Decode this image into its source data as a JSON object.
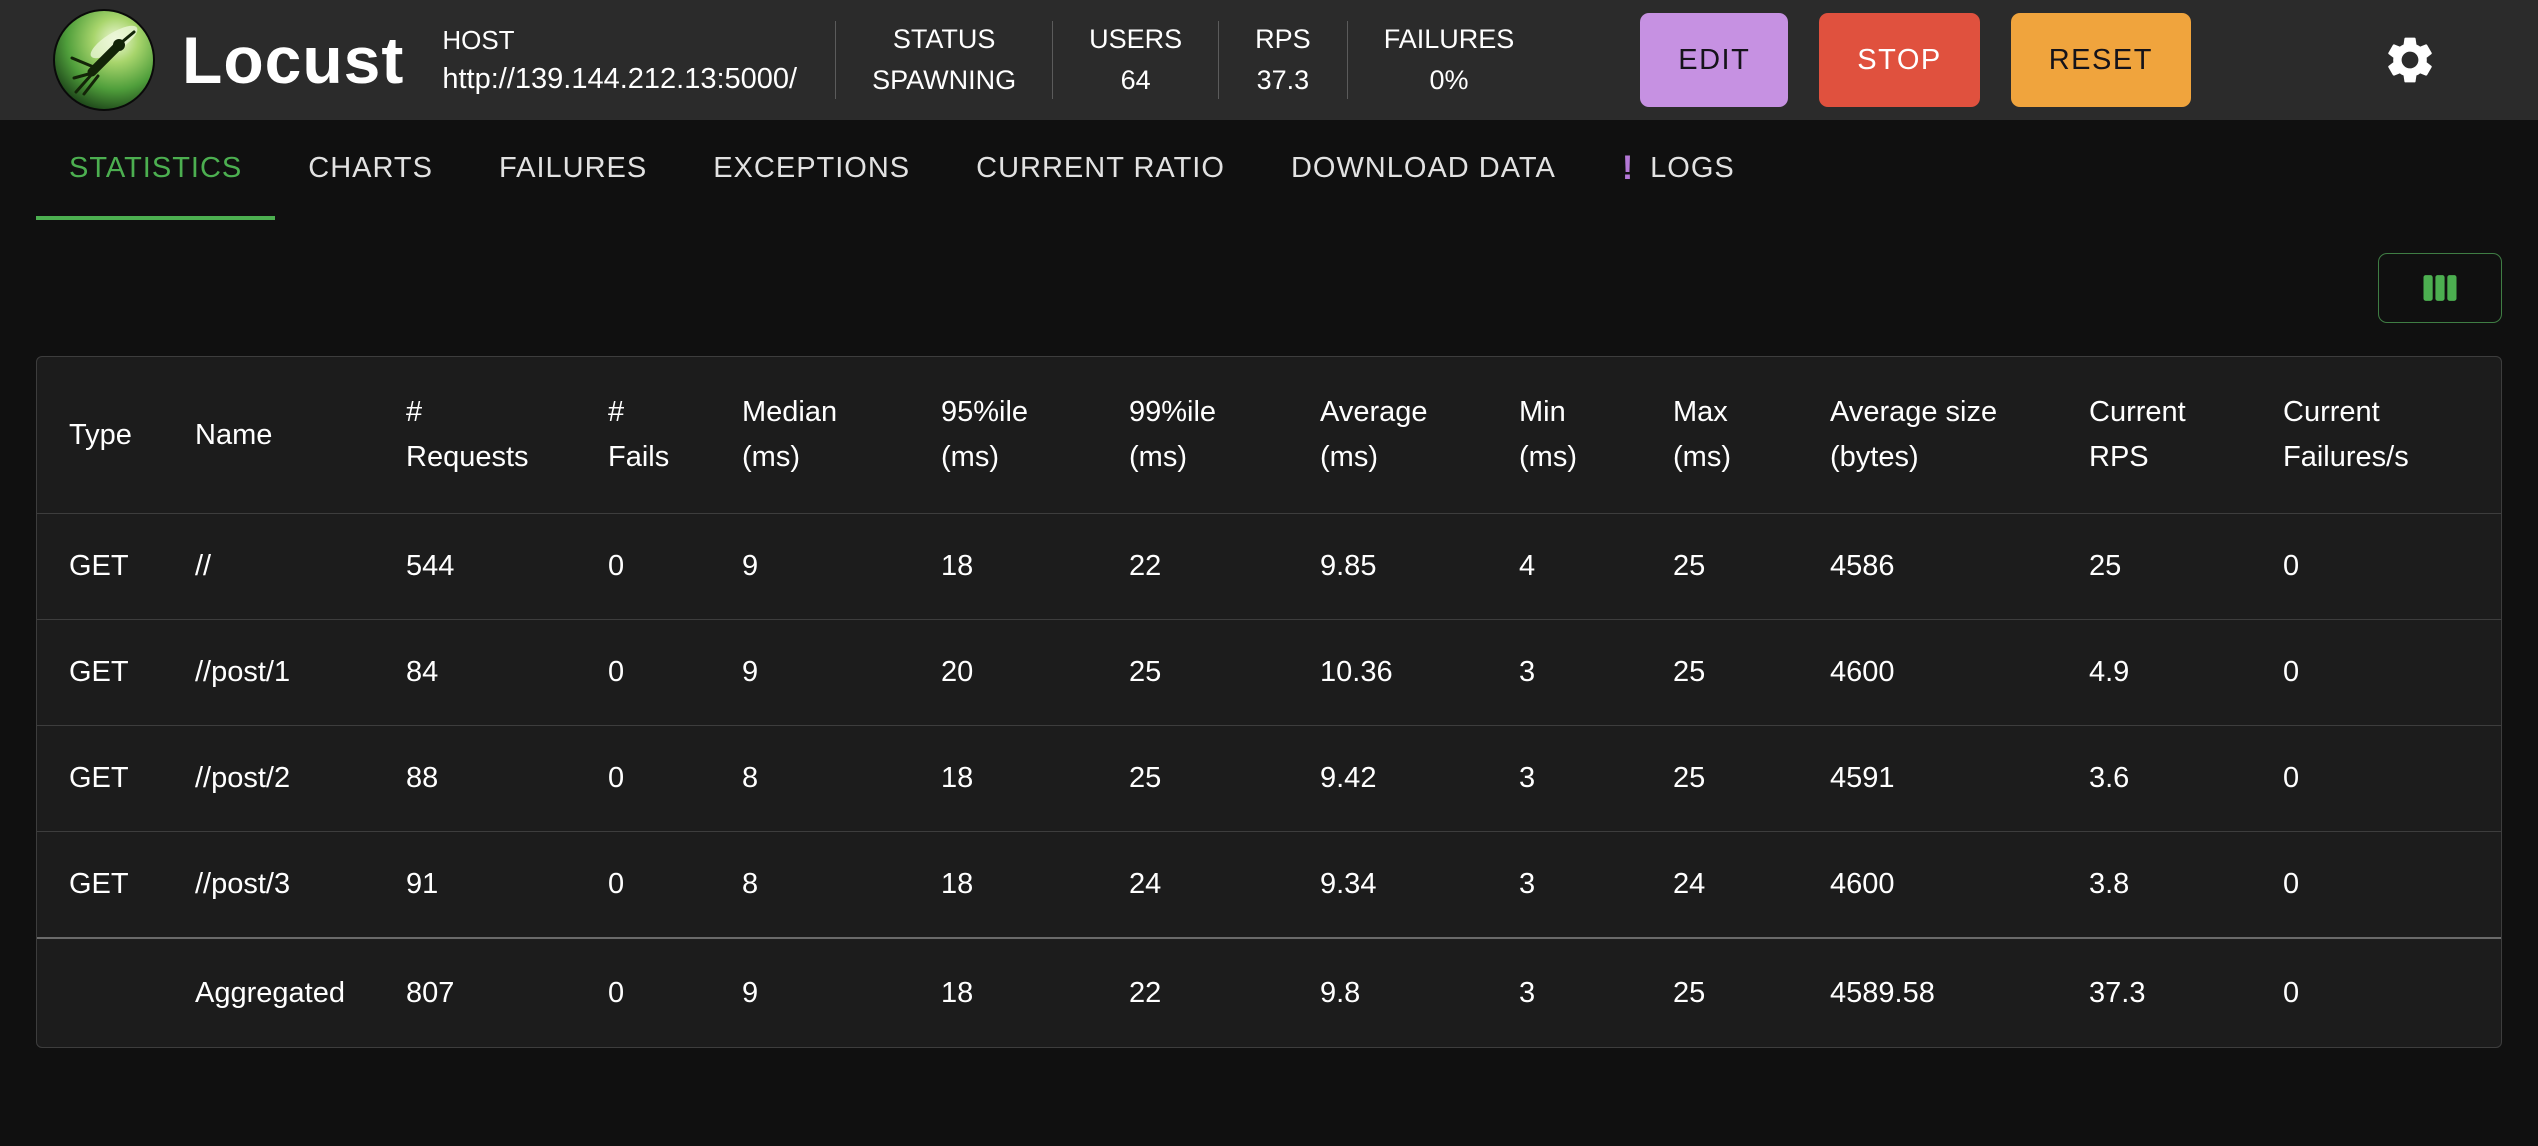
{
  "header": {
    "app_title": "Locust",
    "host_label": "HOST",
    "host_url": "http://139.144.212.13:5000/",
    "stats": [
      {
        "label": "STATUS",
        "value": "SPAWNING"
      },
      {
        "label": "USERS",
        "value": "64"
      },
      {
        "label": "RPS",
        "value": "37.3"
      },
      {
        "label": "FAILURES",
        "value": "0%"
      }
    ],
    "edit_label": "EDIT",
    "stop_label": "STOP",
    "reset_label": "RESET"
  },
  "tabs": [
    {
      "id": "statistics",
      "label": "STATISTICS",
      "active": true
    },
    {
      "id": "charts",
      "label": "CHARTS"
    },
    {
      "id": "failures",
      "label": "FAILURES"
    },
    {
      "id": "exceptions",
      "label": "EXCEPTIONS"
    },
    {
      "id": "current-ratio",
      "label": "CURRENT RATIO"
    },
    {
      "id": "download-data",
      "label": "DOWNLOAD DATA"
    },
    {
      "id": "logs",
      "label": "LOGS",
      "badge": "!"
    }
  ],
  "toolbar": {
    "columns_button_icon": "view-columns-icon"
  },
  "table": {
    "columns": [
      "Type",
      "Name",
      "#\nRequests",
      "#\nFails",
      "Median\n(ms)",
      "95%ile\n(ms)",
      "99%ile\n(ms)",
      "Average\n(ms)",
      "Min\n(ms)",
      "Max\n(ms)",
      "Average size\n(bytes)",
      "Current\nRPS",
      "Current\nFailures/s"
    ],
    "rows": [
      [
        "GET",
        "//",
        "544",
        "0",
        "9",
        "18",
        "22",
        "9.85",
        "4",
        "25",
        "4586",
        "25",
        "0"
      ],
      [
        "GET",
        "//post/1",
        "84",
        "0",
        "9",
        "20",
        "25",
        "10.36",
        "3",
        "25",
        "4600",
        "4.9",
        "0"
      ],
      [
        "GET",
        "//post/2",
        "88",
        "0",
        "8",
        "18",
        "25",
        "9.42",
        "3",
        "25",
        "4591",
        "3.6",
        "0"
      ],
      [
        "GET",
        "//post/3",
        "91",
        "0",
        "8",
        "18",
        "24",
        "9.34",
        "3",
        "24",
        "4600",
        "3.8",
        "0"
      ]
    ],
    "aggregated": [
      "",
      "Aggregated",
      "807",
      "0",
      "9",
      "18",
      "22",
      "9.8",
      "3",
      "25",
      "4589.58",
      "37.3",
      "0"
    ]
  },
  "colors": {
    "page_bg": "#101010",
    "header_bg": "#2b2b2b",
    "panel_bg": "#1c1c1c",
    "accent_green": "#4caf50",
    "edit_purple": "#c691e2",
    "stop_red": "#e0513e",
    "reset_orange": "#f0a43d",
    "badge_purple": "#b478d6"
  }
}
